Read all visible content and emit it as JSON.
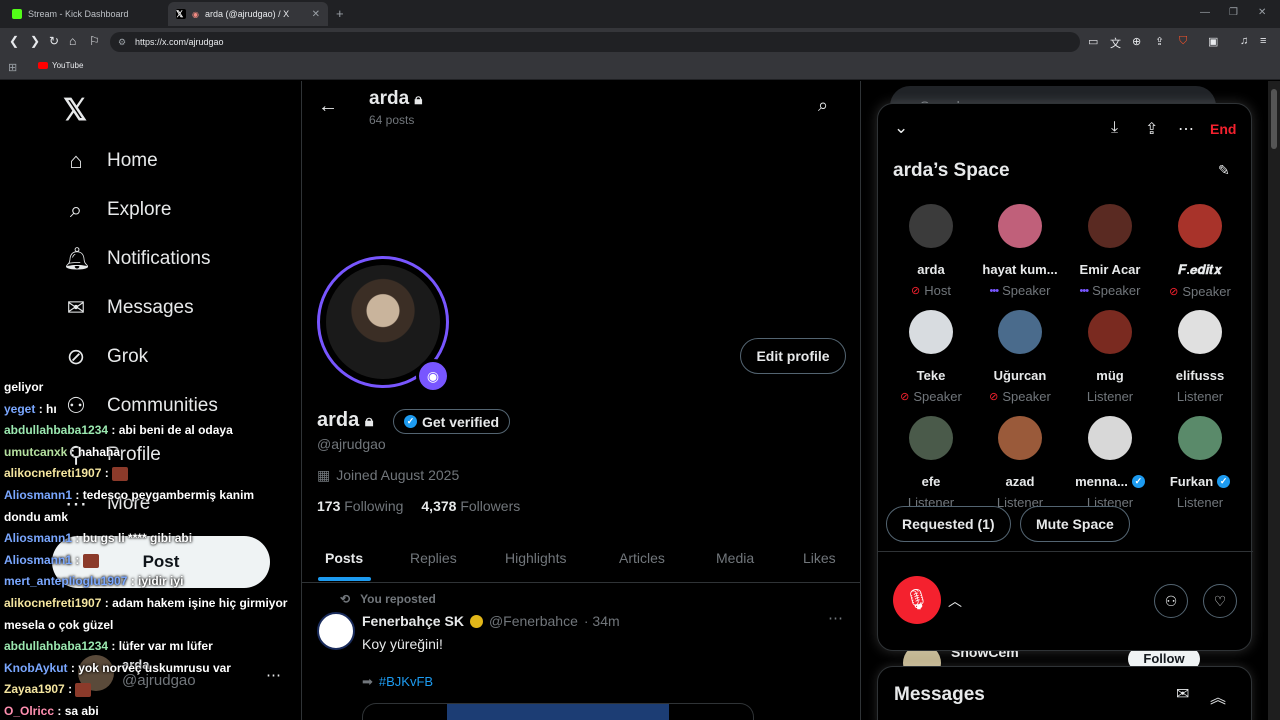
{
  "browser": {
    "tabs": [
      {
        "title": "Stream - Kick Dashboard",
        "favicon_color": "#53fc18"
      },
      {
        "title": "arda (@ajrudgao) / X",
        "favicon_color": "#ffffff"
      }
    ],
    "url": "https://x.com/ajrudgao",
    "bookmark": "YouTube"
  },
  "nav": {
    "items": [
      {
        "label": "Home",
        "icon": "home-icon"
      },
      {
        "label": "Explore",
        "icon": "search-icon"
      },
      {
        "label": "Notifications",
        "icon": "bell-icon"
      },
      {
        "label": "Messages",
        "icon": "mail-icon"
      },
      {
        "label": "Grok",
        "icon": "grok-icon"
      },
      {
        "label": "Communities",
        "icon": "people-icon"
      },
      {
        "label": "Profile",
        "icon": "person-icon"
      },
      {
        "label": "More",
        "icon": "more-icon"
      }
    ],
    "post_label": "Post",
    "account_name": "arda",
    "account_handle": "@ajrudgao"
  },
  "profile": {
    "header_name": "arda",
    "posts_count": "64 posts",
    "name": "arda",
    "get_verified": "Get verified",
    "handle": "@ajrudgao",
    "joined": "Joined August 2025",
    "following_count": "173",
    "following_label": "Following",
    "followers_count": "4,378",
    "followers_label": "Followers",
    "edit_profile": "Edit profile",
    "tabs": [
      "Posts",
      "Replies",
      "Highlights",
      "Articles",
      "Media",
      "Likes"
    ]
  },
  "tweet": {
    "repost_label": "You reposted",
    "author": "Fenerbahçe SK",
    "handle": "@Fenerbahce",
    "time": "· 34m",
    "text": "Koy yüreğini!",
    "hashtag": "#BJKvFB",
    "badge_color": "#e2b719"
  },
  "right": {
    "search_placeholder": "Search",
    "who_name": "ShowCem",
    "follow_label": "Follow",
    "messages_title": "Messages"
  },
  "space": {
    "end_label": "End",
    "title": "arda’s Space",
    "people": [
      {
        "name": "arda",
        "role": "Host",
        "status": "muted",
        "avatar_color": "#3b3b3b"
      },
      {
        "name": "hayat kum...",
        "role": "Speaker",
        "status": "speaking",
        "avatar_color": "#c0607a"
      },
      {
        "name": "Emir Acar",
        "role": "Speaker",
        "status": "speaking",
        "avatar_color": "#5a2a22"
      },
      {
        "name": "𝑭.𝒆𝒅𝒊𝒕𝒙",
        "role": "Speaker",
        "status": "muted",
        "avatar_color": "#a8332a"
      },
      {
        "name": "Teke",
        "role": "Speaker",
        "status": "muted",
        "avatar_color": "#d8dce0"
      },
      {
        "name": "Uğurcan",
        "role": "Speaker",
        "status": "muted",
        "avatar_color": "#4a6b8c"
      },
      {
        "name": "müg",
        "role": "Listener",
        "status": "",
        "avatar_color": "#7a2a20"
      },
      {
        "name": "elifusss",
        "role": "Listener",
        "status": "",
        "avatar_color": "#e0e0e0"
      },
      {
        "name": "efe",
        "role": "Listener",
        "status": "",
        "avatar_color": "#4a5a4a"
      },
      {
        "name": "azad",
        "role": "Listener",
        "status": "",
        "avatar_color": "#9a5a3a"
      },
      {
        "name": "menna...",
        "role": "Listener",
        "status": "verified",
        "avatar_color": "#d8d8d8"
      },
      {
        "name": "Furkan",
        "role": "Listener",
        "status": "verified",
        "avatar_color": "#5a8a6a"
      }
    ],
    "requested_label": "Requested (1)",
    "mute_label": "Mute Space"
  },
  "chat": [
    {
      "user": "",
      "text": "geliyor",
      "color": "#ffffff"
    },
    {
      "user": "yeget",
      "text": ": hı",
      "color": "#7aa7ff"
    },
    {
      "user": "abdullahbaba1234",
      "text": ": abi beni de al odaya",
      "color": "#9be8b0"
    },
    {
      "user": "umutcanxk",
      "text": ": hahaha",
      "color": "#b5e0a0"
    },
    {
      "user": "alikocnefreti1907",
      "text": ":",
      "color": "#f5e6a0"
    },
    {
      "user": "Aliosmann1",
      "text": ": tedesco peygambermiş kanim",
      "color": "#7aa7ff"
    },
    {
      "user": "",
      "text": "dondu amk",
      "color": "#ffffff"
    },
    {
      "user": "Aliosmann1",
      "text": ": bu gs li **** gibi abi",
      "color": "#7aa7ff"
    },
    {
      "user": "Aliosmann1",
      "text": ":",
      "color": "#7aa7ff"
    },
    {
      "user": "mert_antepIioglu1907",
      "text": ": iyidir iyi",
      "color": "#7aa7ff"
    },
    {
      "user": "alikocnefreti1907",
      "text": ": adam hakem işine hiç girmiyor",
      "color": "#f5e6a0"
    },
    {
      "user": "",
      "text": "mesela o çok güzel",
      "color": "#ffffff"
    },
    {
      "user": "abdullahbaba1234",
      "text": ": lüfer var mı lüfer",
      "color": "#9be8b0"
    },
    {
      "user": "KnobAykut",
      "text": ": yok norveç uskumrusu var",
      "color": "#7aa7ff"
    },
    {
      "user": "Zayaa1907",
      "text": ":",
      "color": "#f5e6a0"
    },
    {
      "user": "O_Olricc",
      "text": ": sa abi",
      "color": "#ff8fb0"
    }
  ]
}
